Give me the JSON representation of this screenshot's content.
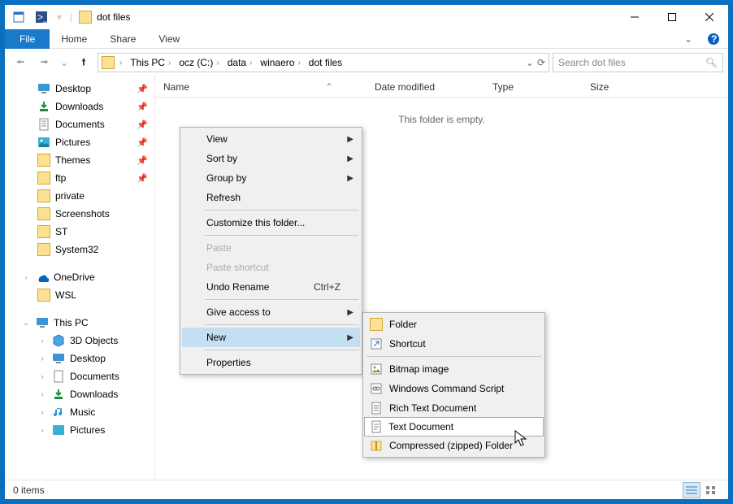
{
  "window": {
    "title": "dot files"
  },
  "ribbon": {
    "file": "File",
    "tabs": [
      "Home",
      "Share",
      "View"
    ]
  },
  "breadcrumbs": [
    "This PC",
    "ocz (C:)",
    "data",
    "winaero",
    "dot files"
  ],
  "search": {
    "placeholder": "Search dot files"
  },
  "sidebar": {
    "quick": [
      {
        "label": "Desktop",
        "icon": "desktop",
        "pinned": true
      },
      {
        "label": "Downloads",
        "icon": "downloads",
        "pinned": true
      },
      {
        "label": "Documents",
        "icon": "documents",
        "pinned": true
      },
      {
        "label": "Pictures",
        "icon": "pictures",
        "pinned": true
      },
      {
        "label": "Themes",
        "icon": "folder",
        "pinned": true
      },
      {
        "label": "ftp",
        "icon": "folder",
        "pinned": true
      },
      {
        "label": "private",
        "icon": "folder",
        "pinned": false
      },
      {
        "label": "Screenshots",
        "icon": "folder",
        "pinned": false
      },
      {
        "label": "ST",
        "icon": "folder",
        "pinned": false
      },
      {
        "label": "System32",
        "icon": "folder",
        "pinned": false
      }
    ],
    "onedrive": "OneDrive",
    "wsl": "WSL",
    "thispc": "This PC",
    "thispc_items": [
      {
        "label": "3D Objects",
        "icon": "3d"
      },
      {
        "label": "Desktop",
        "icon": "desktop"
      },
      {
        "label": "Documents",
        "icon": "documents"
      },
      {
        "label": "Downloads",
        "icon": "downloads"
      },
      {
        "label": "Music",
        "icon": "music"
      },
      {
        "label": "Pictures",
        "icon": "pictures"
      }
    ]
  },
  "columns": {
    "name": "Name",
    "date": "Date modified",
    "type": "Type",
    "size": "Size"
  },
  "empty_message": "This folder is empty.",
  "context_menu": {
    "view": "View",
    "sort": "Sort by",
    "group": "Group by",
    "refresh": "Refresh",
    "customize": "Customize this folder...",
    "paste": "Paste",
    "paste_shortcut": "Paste shortcut",
    "undo": "Undo Rename",
    "undo_key": "Ctrl+Z",
    "give_access": "Give access to",
    "new": "New",
    "properties": "Properties"
  },
  "new_submenu": [
    {
      "label": "Folder",
      "icon": "folder"
    },
    {
      "label": "Shortcut",
      "icon": "shortcut"
    },
    {
      "label": "Bitmap image",
      "icon": "bitmap"
    },
    {
      "label": "Windows Command Script",
      "icon": "cmd"
    },
    {
      "label": "Rich Text Document",
      "icon": "rtf"
    },
    {
      "label": "Text Document",
      "icon": "txt"
    },
    {
      "label": "Compressed (zipped) Folder",
      "icon": "zip"
    }
  ],
  "status": {
    "items": "0 items"
  }
}
